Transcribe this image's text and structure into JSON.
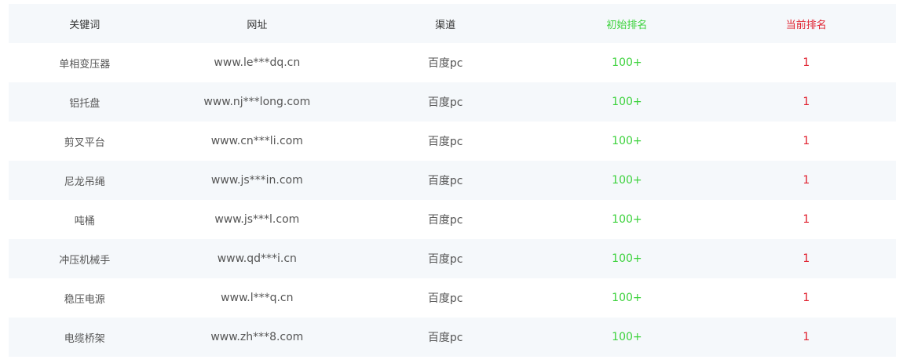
{
  "header": {
    "keyword": "关键词",
    "url": "网址",
    "channel": "渠道",
    "initial_rank": "初始排名",
    "current_rank": "当前排名"
  },
  "rows": [
    {
      "keyword": "单相变压器",
      "url": "www.le***dq.cn",
      "channel": "百度pc",
      "initial_rank": "100+",
      "current_rank": "1"
    },
    {
      "keyword": "铝托盘",
      "url": "www.nj***long.com",
      "channel": "百度pc",
      "initial_rank": "100+",
      "current_rank": "1"
    },
    {
      "keyword": "剪叉平台",
      "url": "www.cn***li.com",
      "channel": "百度pc",
      "initial_rank": "100+",
      "current_rank": "1"
    },
    {
      "keyword": "尼龙吊绳",
      "url": "www.js***in.com",
      "channel": "百度pc",
      "initial_rank": "100+",
      "current_rank": "1"
    },
    {
      "keyword": "吨桶",
      "url": "www.js***l.com",
      "channel": "百度pc",
      "initial_rank": "100+",
      "current_rank": "1"
    },
    {
      "keyword": "冲压机械手",
      "url": "www.qd***i.cn",
      "channel": "百度pc",
      "initial_rank": "100+",
      "current_rank": "1"
    },
    {
      "keyword": "稳压电源",
      "url": "www.l***q.cn",
      "channel": "百度pc",
      "initial_rank": "100+",
      "current_rank": "1"
    },
    {
      "keyword": "电缆桥架",
      "url": "www.zh***8.com",
      "channel": "百度pc",
      "initial_rank": "100+",
      "current_rank": "1"
    }
  ],
  "colors": {
    "initial_rank": "#3cd23c",
    "current_rank": "#e0202e",
    "row_shade": "#f5f8fb"
  }
}
